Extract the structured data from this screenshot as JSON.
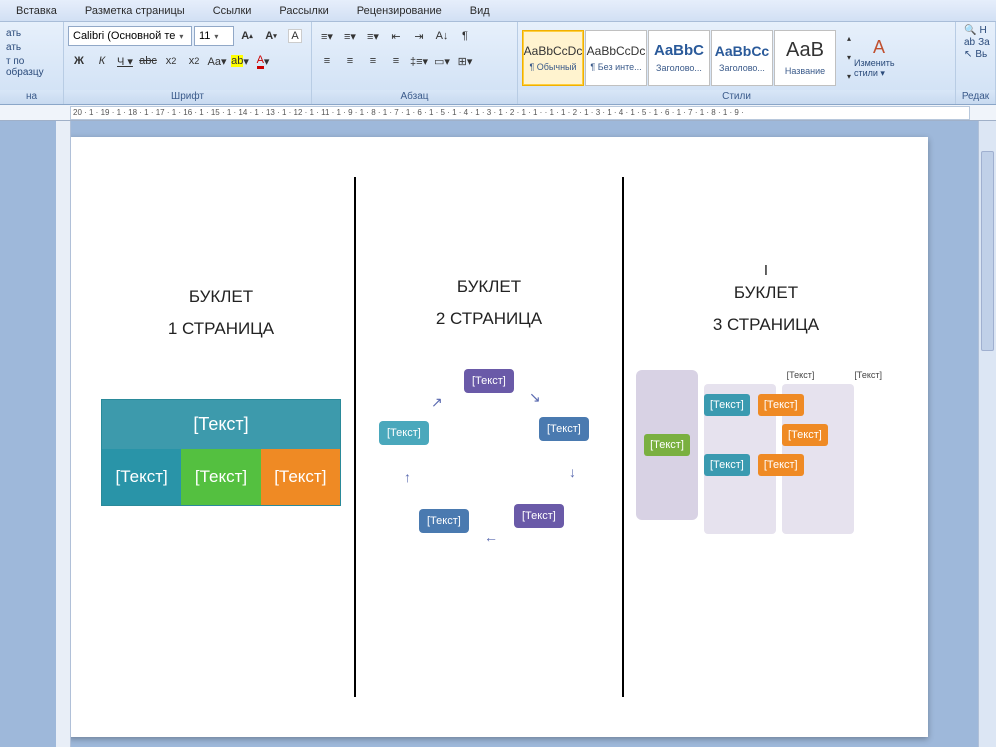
{
  "menu": {
    "items": [
      "Вставка",
      "Разметка страницы",
      "Ссылки",
      "Рассылки",
      "Рецензирование",
      "Вид"
    ]
  },
  "clipboard": {
    "paste_hint": "ать",
    "copy_hint": "ать",
    "format_painter": "т по образцу",
    "label": "на"
  },
  "font": {
    "family": "Calibri (Основной те",
    "size": "11",
    "label": "Шрифт"
  },
  "paragraph": {
    "label": "Абзац"
  },
  "styles": {
    "label": "Стили",
    "items": [
      {
        "preview": "AaBbCcDc",
        "name": "¶ Обычный",
        "selected": true
      },
      {
        "preview": "AaBbCcDc",
        "name": "¶ Без инте..."
      },
      {
        "preview": "AaBbC",
        "name": "Заголово...",
        "big": true,
        "color": "#2a5a9a"
      },
      {
        "preview": "AaBbCc",
        "name": "Заголово...",
        "big": true,
        "color": "#2a5a9a"
      },
      {
        "preview": "АаВ",
        "name": "Название",
        "huge": true
      }
    ],
    "change": "Изменить стили ▾"
  },
  "editing": {
    "label": "Редак",
    "find": "Н",
    "replace": "За",
    "select": "Вь"
  },
  "ruler": "20 · 1 · 19 · 1 · 18 · 1 · 17 · 1 · 16 · 1 · 15 · 1 · 14 · 1 · 13 · 1 · 12 · 1 · 11      · 1 · 9 · 1 · 8 · 1 · 7 · 1 · 6 · 1 · 5 · 1 · 4 · 1 · 3 · 1 · 2 · 1 · 1 ·      · 1 · 1 · 2 · 1 · 3 · 1 · 4 · 1 · 5 · 1 · 6 · 1 · 7 · 1 · 8 · 1 · 9 ·",
  "doc": {
    "col1": {
      "title": "БУКЛЕТ",
      "sub": "1 СТРАНИЦА",
      "ph": "[Текст]"
    },
    "col2": {
      "title": "БУКЛЕТ",
      "sub": "2 СТРАНИЦА",
      "ph": "[Текст]"
    },
    "col3": {
      "roman": "I",
      "title": "БУКЛЕТ",
      "sub": "3 СТРАНИЦА",
      "ph": "[Текст]"
    }
  }
}
